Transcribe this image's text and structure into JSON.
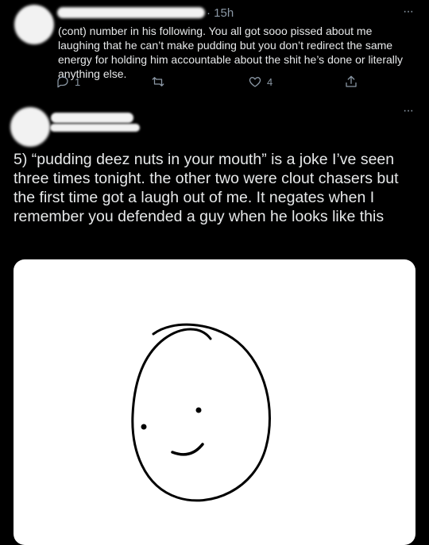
{
  "tweet_cont": {
    "time": "· 15h",
    "text": "(cont) number in his following. You all got sooo pissed about me laughing that he can’t make pudding but you don’t redirect the same energy for holding him accountable about the shit he’s done or literally anything else.",
    "reply_count": "1",
    "like_count": "4",
    "more_label": "···"
  },
  "tweet_main": {
    "text": "5) “pudding deez nuts in your mouth” is a joke I’ve seen three times tonight. the other two were clout chasers but the first time got a laugh out of me. It negates when I remember you defended a guy when he looks like this",
    "more_label": "···",
    "media_alt": "smiley-face-drawing"
  },
  "icons": [
    "reply-icon",
    "retweet-icon",
    "like-icon",
    "share-icon",
    "more-icon",
    "smiley-face-drawing"
  ]
}
